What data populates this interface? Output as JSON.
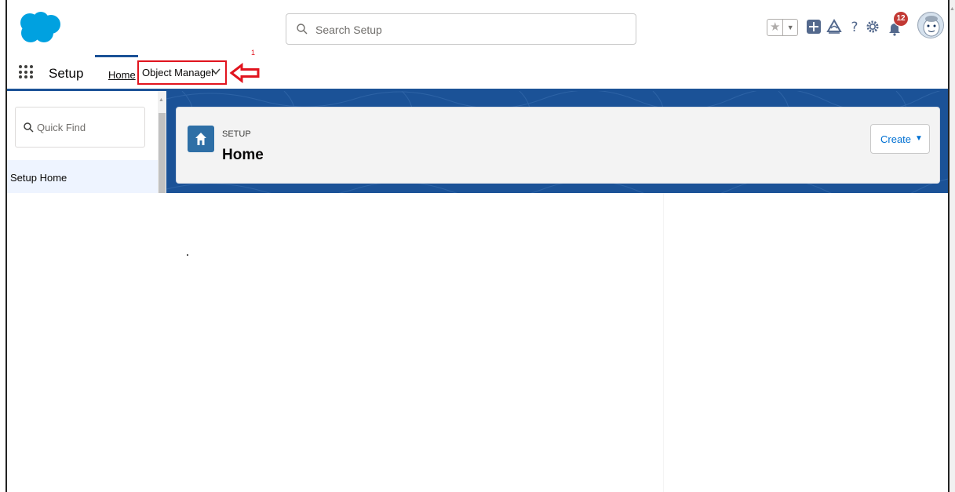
{
  "header": {
    "search_placeholder": "Search Setup",
    "notification_count": "12",
    "icons": [
      "salesforce-cloud-logo",
      "search-icon",
      "favorite-star-icon",
      "favorites-dropdown-icon",
      "global-actions-add-icon",
      "trailhead-icon",
      "help-icon",
      "setup-gear-icon",
      "notifications-bell-icon",
      "user-avatar"
    ]
  },
  "nav": {
    "app_name": "Setup",
    "tabs": [
      {
        "label": "Home",
        "active": true
      },
      {
        "label": "Object Manager",
        "has_dropdown": true
      }
    ],
    "annotation_step": "1"
  },
  "sidebar": {
    "quick_find_placeholder": "Quick Find",
    "items": [
      {
        "label": "Setup Home"
      }
    ]
  },
  "page_header": {
    "subtitle": "SETUP",
    "title": "Home",
    "create_label": "Create"
  },
  "colors": {
    "brand_blue": "#1b5297",
    "logo_blue": "#00a1e0",
    "link_blue": "#0070d2",
    "annotation_red": "#e1141e",
    "badge_red": "#c23934"
  }
}
